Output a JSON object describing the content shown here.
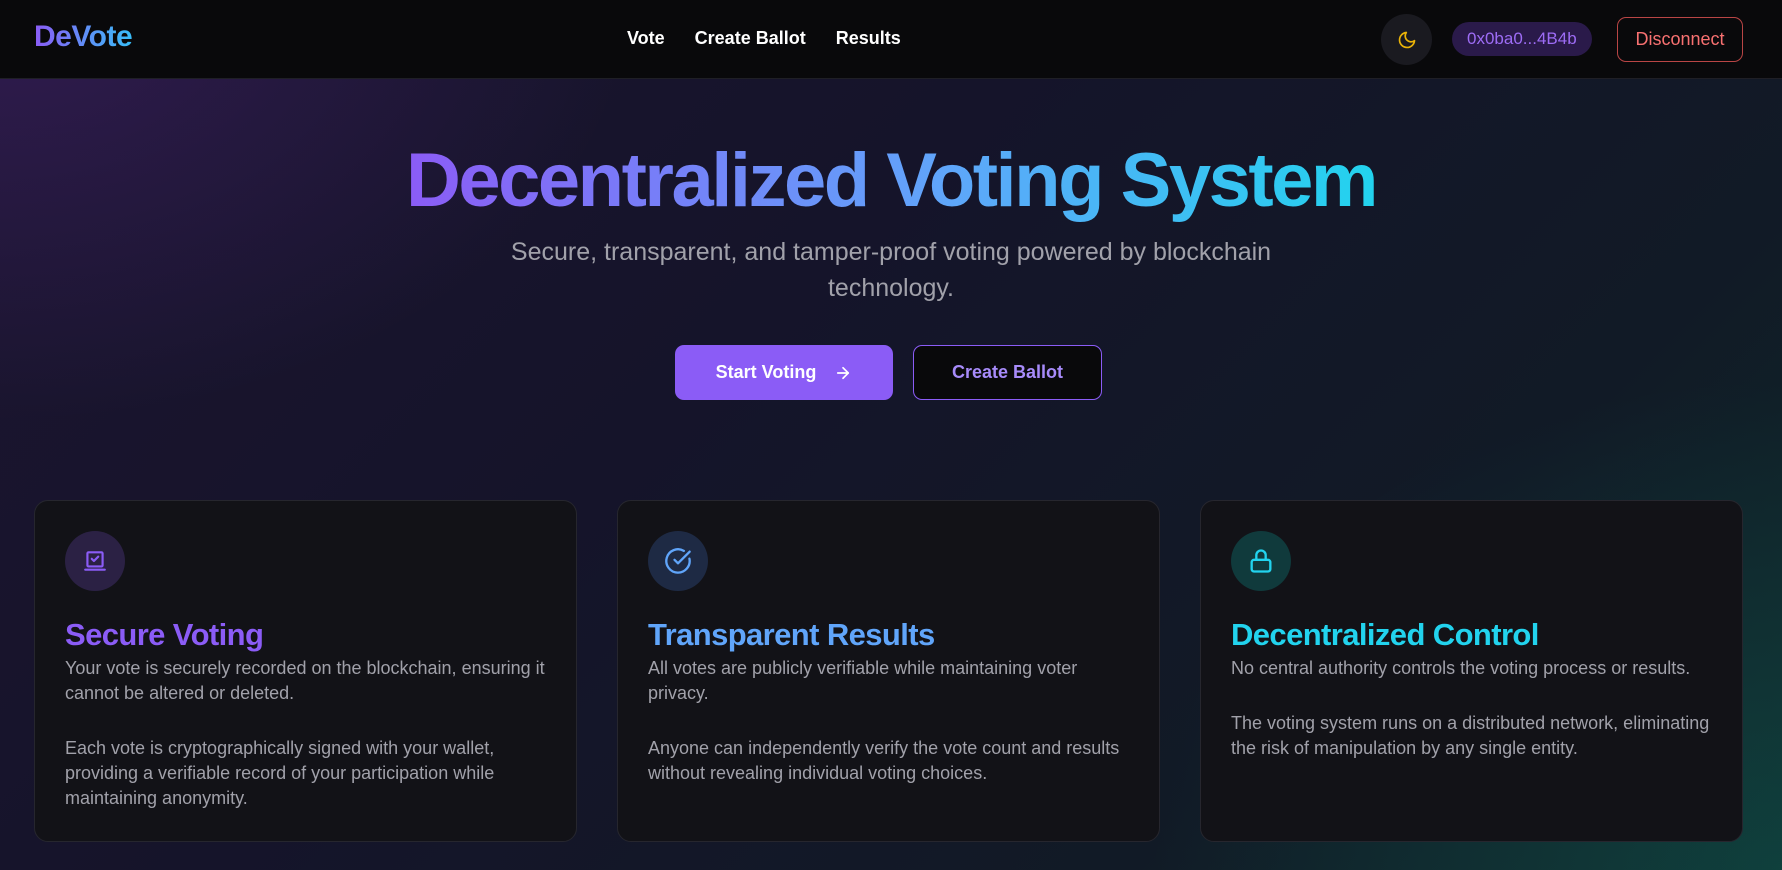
{
  "header": {
    "logo": "DeVote",
    "nav": [
      {
        "label": "Vote"
      },
      {
        "label": "Create Ballot"
      },
      {
        "label": "Results"
      }
    ],
    "theme_icon": "moon-icon",
    "wallet_address": "0x0ba0...4B4b",
    "disconnect_label": "Disconnect"
  },
  "hero": {
    "title": "Decentralized Voting System",
    "subtitle": "Secure, transparent, and tamper-proof voting powered by blockchain technology.",
    "primary_button": "Start Voting",
    "primary_icon": "arrow-right-icon",
    "secondary_button": "Create Ballot"
  },
  "features": [
    {
      "icon": "ballot-box-icon",
      "title": "Secure Voting",
      "description": "Your vote is securely recorded on the blockchain, ensuring it cannot be altered or deleted.",
      "detail": "Each vote is cryptographically signed with your wallet, providing a verifiable record of your participation while maintaining anonymity."
    },
    {
      "icon": "check-circle-icon",
      "title": "Transparent Results",
      "description": "All votes are publicly verifiable while maintaining voter privacy.",
      "detail": "Anyone can independently verify the vote count and results without revealing individual voting choices."
    },
    {
      "icon": "lock-icon",
      "title": "Decentralized Control",
      "description": "No central authority controls the voting process or results.",
      "detail": "The voting system runs on a distributed network, eliminating the risk of manipulation by any single entity."
    }
  ],
  "colors": {
    "accent_purple": "#8b5cf6",
    "accent_blue": "#60a5fa",
    "accent_cyan": "#22d3ee",
    "danger": "#f87171"
  }
}
